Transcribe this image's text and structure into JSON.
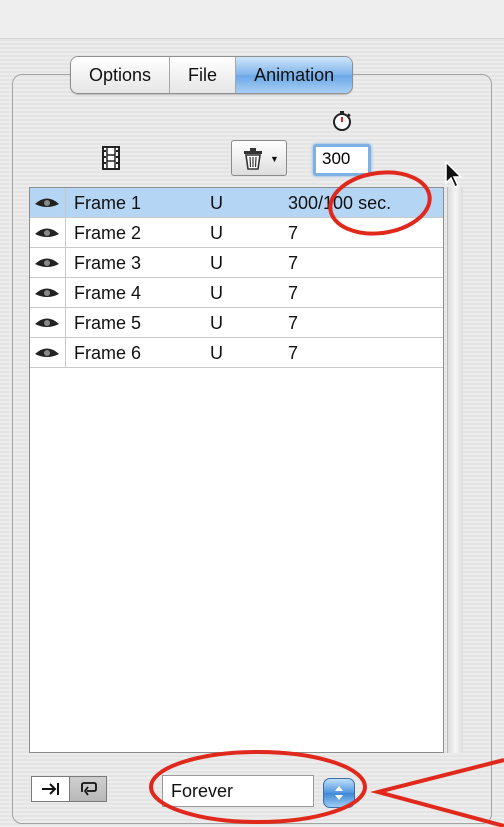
{
  "tabs": [
    {
      "label": "Options",
      "active": false
    },
    {
      "label": "File",
      "active": false
    },
    {
      "label": "Animation",
      "active": true
    }
  ],
  "toolbar": {
    "film_icon": "film-strip-icon",
    "trash_icon": "trash-icon",
    "timer_icon": "timer-icon",
    "delay_value": "300"
  },
  "frames": [
    {
      "name": "Frame 1",
      "disposal": "U",
      "delay": "300/100 sec.",
      "selected": true
    },
    {
      "name": "Frame 2",
      "disposal": "U",
      "delay": "7",
      "selected": false
    },
    {
      "name": "Frame 3",
      "disposal": "U",
      "delay": "7",
      "selected": false
    },
    {
      "name": "Frame 4",
      "disposal": "U",
      "delay": "7",
      "selected": false
    },
    {
      "name": "Frame 5",
      "disposal": "U",
      "delay": "7",
      "selected": false
    },
    {
      "name": "Frame 6",
      "disposal": "U",
      "delay": "7",
      "selected": false
    }
  ],
  "loop": {
    "mode_buttons": [
      "play-once-icon",
      "loop-icon"
    ],
    "selected_value": "Forever"
  },
  "colors": {
    "selection": "#b5d5f5",
    "active_tab": "#6aa7e6",
    "annotation": "#e0291c"
  }
}
